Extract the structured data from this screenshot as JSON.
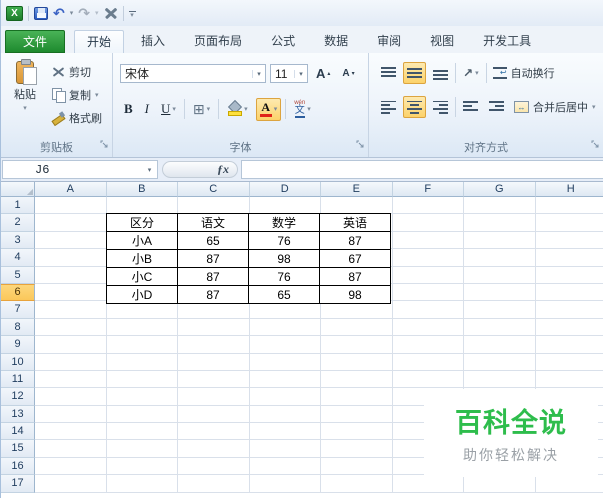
{
  "tabs": {
    "items": [
      "文件",
      "开始",
      "插入",
      "页面布局",
      "公式",
      "数据",
      "审阅",
      "视图",
      "开发工具"
    ],
    "active": "开始"
  },
  "ribbon": {
    "clipboard": {
      "label": "剪贴板",
      "paste": "粘贴",
      "cut": "剪切",
      "copy": "复制",
      "format_painter": "格式刷"
    },
    "font": {
      "label": "字体",
      "font_name": "宋体",
      "font_size": "11",
      "bold": "B",
      "italic": "I",
      "underline": "U"
    },
    "alignment": {
      "label": "对齐方式",
      "wrap_text": "自动换行",
      "merge_center": "合并后居中"
    }
  },
  "formula_bar": {
    "name_box": "J6",
    "formula": ""
  },
  "sheet": {
    "columns": [
      "A",
      "B",
      "C",
      "D",
      "E",
      "F",
      "G",
      "H"
    ],
    "row_count": 17,
    "selected_row": 6,
    "table": {
      "start_cell": "B2",
      "headers": [
        "区分",
        "语文",
        "数学",
        "英语"
      ],
      "rows": [
        [
          "小A",
          "65",
          "76",
          "87"
        ],
        [
          "小B",
          "87",
          "98",
          "67"
        ],
        [
          "小C",
          "87",
          "76",
          "87"
        ],
        [
          "小D",
          "87",
          "65",
          "98"
        ]
      ]
    }
  },
  "watermark": {
    "title": "百科全说",
    "subtitle": "助你轻松解决",
    "title_color": "#2ebd4c",
    "subtitle_color": "#9aa0a6"
  },
  "icons": {
    "excel_logo_letter": "X",
    "undo": "↶",
    "redo": "↷",
    "dropdown": "▾",
    "font_letter": "A",
    "up_caret": "▴",
    "down_caret": "▾",
    "border_grid": "⊞",
    "phonetic_pinyin": "wén",
    "phonetic_main": "文",
    "orientation": "↗",
    "wrap_return": "↩",
    "merge_arrows": "↔",
    "fx": "ƒx",
    "corner_triangle": "◢"
  },
  "colors": {
    "file_tab_green": "#1e8a2e",
    "highlight_orange": "#fcd26a",
    "selected_row_header": "#fbc75a",
    "watermark_green": "#2ebd4c"
  }
}
